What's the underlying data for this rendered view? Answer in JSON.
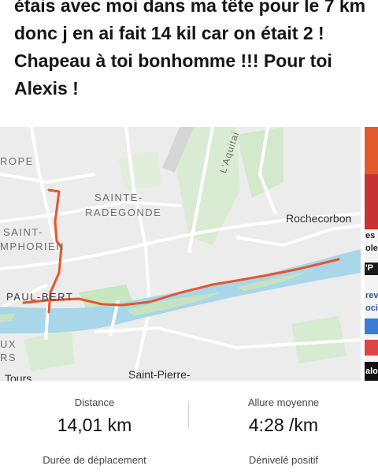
{
  "post": {
    "caption": "étais avec moi dans ma tête pour le 7 km donc j en ai fait 14 kil car on était 2 ! Chapeau à toi bonhomme !!! Pour toi Alexis !"
  },
  "map": {
    "labels": {
      "rope": "ROPE",
      "sainte_radegonde_1": "SAINTE-",
      "sainte_radegonde_2": "RADEGONDE",
      "saint_symphorien_1": "SAINT-",
      "saint_symphorien_2": "MPHORIEN",
      "paul_bert": "PAUL-BERT",
      "aquitaine": "L'Aquitai",
      "rochecorbon": "Rochecorbon",
      "saint_pierre": "Saint-Pierre-",
      "ux": "UX",
      "rs": "RS",
      "tours": "Tours"
    },
    "route_color": "#e8552a",
    "water_color": "#a9d6e8",
    "park_color": "#c8e6c0"
  },
  "side_card": {
    "text1": "es",
    "text2": "ole",
    "text3": "'P",
    "text4": "rev",
    "text5": "oci",
    "text6": "alo"
  },
  "stats": {
    "distance_label": "Distance",
    "distance_value": "14,01 km",
    "pace_label": "Allure moyenne",
    "pace_value": "4:28 /km",
    "moving_time_label": "Durée de déplacement",
    "elevation_label": "Dénivelé positif"
  }
}
